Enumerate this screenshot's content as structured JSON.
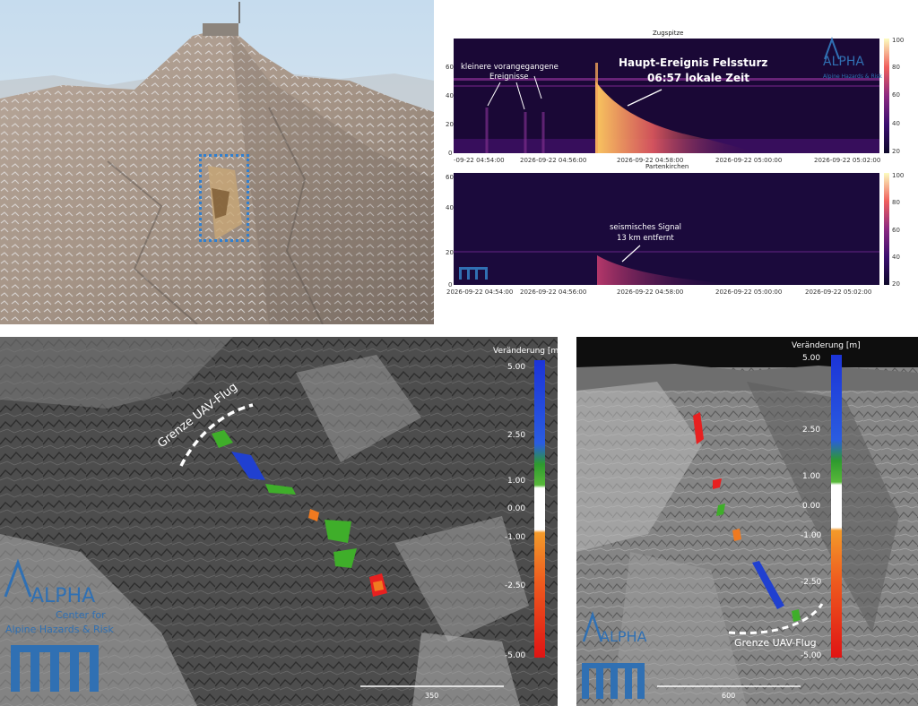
{
  "spectrogram_top": {
    "title": "Zugspitze",
    "annotation_small": [
      "kleinere vorangegangene",
      "Ereignisse"
    ],
    "annotation_main": [
      "Haupt-Ereignis Felssturz",
      "06:57 lokale Zeit"
    ],
    "y_ticks": [
      "60",
      "40",
      "20",
      "0"
    ],
    "x_ticks": [
      "-09-22 04:54:00",
      "2026-09-22 04:56:00",
      "2026-09-22 04:58:00",
      "2026-09-22 05:00:00",
      "2026-09-22 05:02:00"
    ],
    "cbar_ticks": [
      "100",
      "80",
      "60",
      "40",
      "20"
    ]
  },
  "spectrogram_bottom": {
    "title": "Partenkirchen",
    "annotation": [
      "seismisches Signal",
      "13 km entfernt"
    ],
    "y_ticks": [
      "60",
      "40",
      "20",
      "0"
    ],
    "x_ticks": [
      "2026-09-22 04:54:00",
      "2026-09-22 04:56:00",
      "2026-09-22 04:58:00",
      "2026-09-22 05:00:00",
      "2026-09-22 05:02:00"
    ],
    "cbar_ticks": [
      "100",
      "80",
      "60",
      "40",
      "20"
    ]
  },
  "alpha_logo": {
    "word": "ALPHA",
    "sub_line1": "Center for",
    "sub_line2": "Alpine Hazards & Risk"
  },
  "tum_logo": "TUM",
  "dem_left": {
    "legend_title": "Veränderung [m]",
    "legend_ticks": [
      "5.00",
      "2.50",
      "1.00",
      "0.00",
      "-1.00",
      "-2.50",
      "-5.00"
    ],
    "boundary_label": "Grenze UAV-Flug",
    "scale_label": "350"
  },
  "dem_right": {
    "legend_title": "Veränderung [m]",
    "legend_ticks": [
      "5.00",
      "2.50",
      "1.00",
      "0.00",
      "-1.00",
      "-2.50",
      "-5.00"
    ],
    "boundary_label": "Grenze UAV-Flug",
    "scale_label": "600"
  },
  "colors": {
    "tum_blue": "#3070b3",
    "highlight_box": "#2f7fd0",
    "loss_red": "#e82020",
    "gain_blue": "#2040d0",
    "gain_green": "#3fae2a",
    "loss_orange": "#f07a20"
  }
}
